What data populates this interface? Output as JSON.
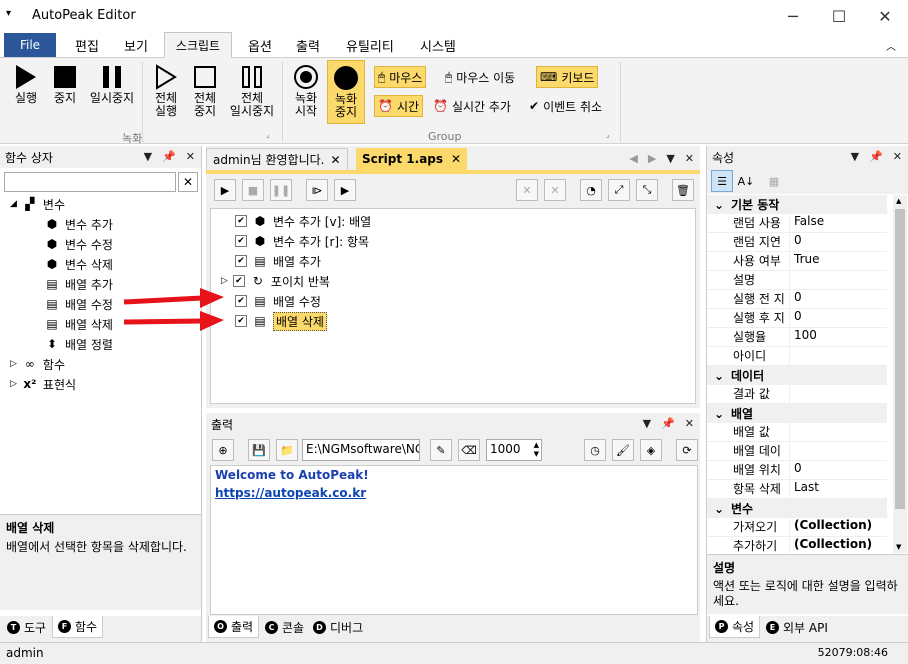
{
  "window": {
    "title": "AutoPeak Editor",
    "minimize": "─",
    "maximize": "☐",
    "close": "✕"
  },
  "menu": {
    "file": "File",
    "items": [
      "편집",
      "보기",
      "스크립트",
      "옵션",
      "출력",
      "유틸리티",
      "시스템"
    ]
  },
  "ribbon": {
    "buttons": [
      {
        "label1": "실행",
        "label2": ""
      },
      {
        "label1": "중지",
        "label2": ""
      },
      {
        "label1": "일시중지",
        "label2": ""
      },
      {
        "label1": "전체",
        "label2": "실행"
      },
      {
        "label1": "전체",
        "label2": "중지"
      },
      {
        "label1": "전체",
        "label2": "일시중지"
      },
      {
        "label1": "녹화",
        "label2": "시작"
      },
      {
        "label1": "녹화",
        "label2": "중지"
      }
    ],
    "small": {
      "mouse": "마우스",
      "mouse_move": "마우스 이동",
      "keyboard": "키보드",
      "time": "시간",
      "realtime_add": "실시간 추가",
      "event_cancel": "이벤트 취소"
    },
    "group_record": "녹화",
    "group_group": "Group"
  },
  "left_panel": {
    "title": "함수 상자",
    "tree": {
      "variables": "변수",
      "var_add": "변수 추가",
      "var_edit": "변수 수정",
      "var_delete": "변수 삭제",
      "arr_add": "배열 추가",
      "arr_edit": "배열 수정",
      "arr_delete": "배열 삭제",
      "arr_sort": "배열 정렬",
      "functions": "함수",
      "expressions": "표현식"
    },
    "desc_title": "배열 삭제",
    "desc_text": "배열에서 선택한 항목을 삭제합니다.",
    "tabs": {
      "tools": "도구",
      "functions": "함수",
      "tools_icon": "T",
      "functions_icon": "F"
    }
  },
  "editor": {
    "tab1": "admin님 환영합니다.",
    "tab2": "Script 1.aps",
    "lines": [
      "변수 추가 [v]: 배열",
      "변수 추가 [r]: 항목",
      "배열 추가",
      "포이치 반복",
      "배열 수정",
      "배열 삭제"
    ]
  },
  "output": {
    "title": "출력",
    "path": "E:\\NGMsoftware\\NG",
    "count": "1000",
    "welcome": "Welcome to AutoPeak!",
    "link": "https://autopeak.co.kr",
    "tabs": {
      "output": "출력",
      "console": "콘솔",
      "debug": "디버그",
      "output_icon": "O",
      "console_icon": "C",
      "debug_icon": "D"
    }
  },
  "props": {
    "title": "속성",
    "cat_basic": "기본 동작",
    "rows_basic": [
      [
        "랜덤 사용",
        "False"
      ],
      [
        "랜덤 지연",
        "0"
      ],
      [
        "사용 여부",
        "True"
      ],
      [
        "설명",
        ""
      ],
      [
        "실행 전 지",
        "0"
      ],
      [
        "실행 후 지",
        "0"
      ],
      [
        "실행율",
        "100"
      ],
      [
        "아이디",
        ""
      ]
    ],
    "cat_data": "데이터",
    "rows_data": [
      [
        "결과 값",
        ""
      ]
    ],
    "cat_array": "배열",
    "rows_array": [
      [
        "배열 값",
        ""
      ],
      [
        "배열 데이",
        ""
      ],
      [
        "배열 위치",
        "0"
      ],
      [
        "항목 삭제",
        "Last"
      ]
    ],
    "cat_var": "변수",
    "rows_var": [
      [
        "가져오기",
        "(Collection)"
      ],
      [
        "추가하기",
        "(Collection)"
      ]
    ],
    "desc_title": "설명",
    "desc_text": "액션 또는 로직에 대한 설명을 입력하세요.",
    "tabs": {
      "props": "속성",
      "external": "외부 API",
      "props_icon": "P",
      "external_icon": "E"
    }
  },
  "status": {
    "user": "admin",
    "time": "52079:08:46"
  },
  "colors": {
    "accent": "#2b579a",
    "highlight": "#fbd96a",
    "arrow": "#e8121b",
    "link": "#0b45b5"
  }
}
